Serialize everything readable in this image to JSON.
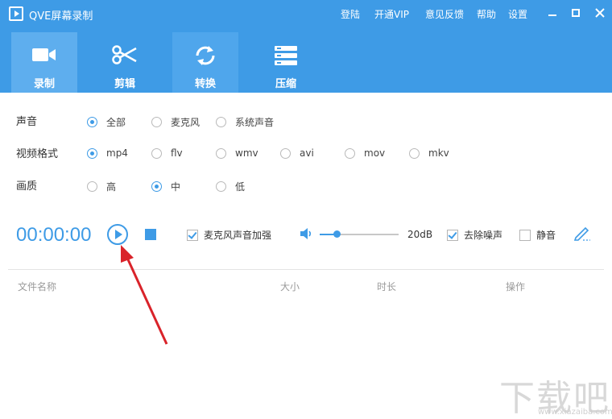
{
  "app": {
    "title": "QVE屏幕录制"
  },
  "menu": {
    "login": "登陆",
    "vip": "开通VIP",
    "feedback": "意见反馈",
    "help": "帮助",
    "settings": "设置"
  },
  "tabs": [
    {
      "label": "录制",
      "icon": "video-camera-icon",
      "active": true
    },
    {
      "label": "剪辑",
      "icon": "scissors-icon"
    },
    {
      "label": "转换",
      "icon": "refresh-icon"
    },
    {
      "label": "压缩",
      "icon": "compress-icon"
    }
  ],
  "sound": {
    "label": "声音",
    "options": [
      "全部",
      "麦克风",
      "系统声音"
    ],
    "selected": "全部"
  },
  "format": {
    "label": "视频格式",
    "options": [
      "mp4",
      "flv",
      "wmv",
      "avi",
      "mov",
      "mkv"
    ],
    "selected": "mp4"
  },
  "quality": {
    "label": "画质",
    "options": [
      "高",
      "中",
      "低"
    ],
    "selected": "中"
  },
  "controls": {
    "timer": "00:00:00",
    "mic_boost": {
      "label": "麦克风声音加强",
      "checked": true
    },
    "volume_value": "20dB",
    "volume_level": 0.2,
    "denoise": {
      "label": "去除噪声",
      "checked": true
    },
    "mute": {
      "label": "静音",
      "checked": false
    }
  },
  "table": {
    "columns": [
      "文件名称",
      "大小",
      "时长",
      "操作"
    ]
  },
  "watermark": {
    "text": "下载吧",
    "sub": "www.xiazaiba.com"
  },
  "colors": {
    "accent": "#3e9be6",
    "arrow": "#d9232a"
  }
}
